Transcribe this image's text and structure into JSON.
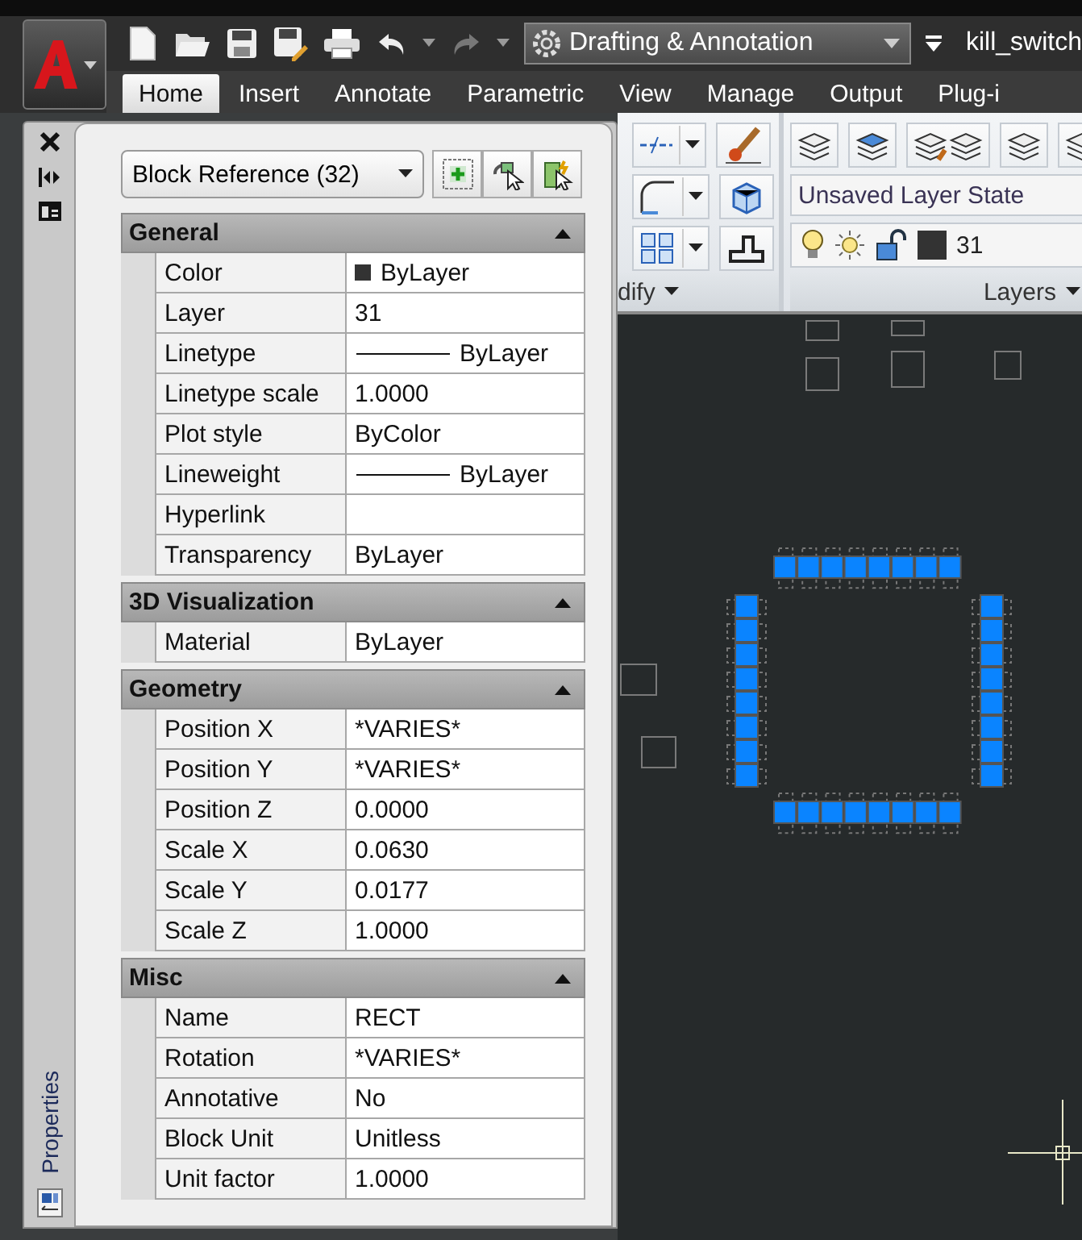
{
  "quick_access": {
    "workspace": "Drafting & Annotation"
  },
  "title": "kill_switch",
  "ribbon_tabs": [
    {
      "label": "Home",
      "selected": true
    },
    {
      "label": "Insert",
      "selected": false
    },
    {
      "label": "Annotate",
      "selected": false
    },
    {
      "label": "Parametric",
      "selected": false
    },
    {
      "label": "View",
      "selected": false
    },
    {
      "label": "Manage",
      "selected": false
    },
    {
      "label": "Output",
      "selected": false
    },
    {
      "label": "Plug-i",
      "selected": false
    }
  ],
  "ribbon": {
    "modify_panel": {
      "title": "dify"
    },
    "layers_panel": {
      "title": "Layers",
      "layer_state": "Unsaved Layer State",
      "current_layer": "31"
    }
  },
  "properties_palette": {
    "title": "Properties",
    "selection": "Block Reference (32)",
    "sections": [
      {
        "title": "General",
        "expanded": true,
        "rows": [
          {
            "label": "Color",
            "value": "ByLayer",
            "kind": "color"
          },
          {
            "label": "Layer",
            "value": "31",
            "kind": "text"
          },
          {
            "label": "Linetype",
            "value": "ByLayer",
            "kind": "line"
          },
          {
            "label": "Linetype scale",
            "value": "1.0000",
            "kind": "text"
          },
          {
            "label": "Plot style",
            "value": "ByColor",
            "kind": "text"
          },
          {
            "label": "Lineweight",
            "value": "ByLayer",
            "kind": "line"
          },
          {
            "label": "Hyperlink",
            "kind": "text"
          },
          {
            "label": "Transparency",
            "value": "ByLayer",
            "kind": "text"
          }
        ]
      },
      {
        "title": "3D Visualization",
        "expanded": true,
        "rows": [
          {
            "label": "Material",
            "value": "ByLayer",
            "kind": "text"
          }
        ]
      },
      {
        "title": "Geometry",
        "expanded": true,
        "rows": [
          {
            "label": "Position X",
            "value": "*VARIES*",
            "kind": "text"
          },
          {
            "label": "Position Y",
            "value": "*VARIES*",
            "kind": "text"
          },
          {
            "label": "Position Z",
            "value": "0.0000",
            "kind": "text"
          },
          {
            "label": "Scale X",
            "value": "0.0630",
            "kind": "text"
          },
          {
            "label": "Scale Y",
            "value": "0.0177",
            "kind": "text"
          },
          {
            "label": "Scale Z",
            "value": "1.0000",
            "kind": "text"
          }
        ]
      },
      {
        "title": "Misc",
        "expanded": true,
        "rows": [
          {
            "label": "Name",
            "value": "RECT",
            "kind": "text"
          },
          {
            "label": "Rotation",
            "value": "*VARIES*",
            "kind": "text"
          },
          {
            "label": "Annotative",
            "value": "No",
            "kind": "text"
          },
          {
            "label": "Block Unit",
            "value": "Unitless",
            "kind": "text"
          },
          {
            "label": "Unit factor",
            "value": "1.0000",
            "kind": "text"
          }
        ]
      }
    ]
  }
}
